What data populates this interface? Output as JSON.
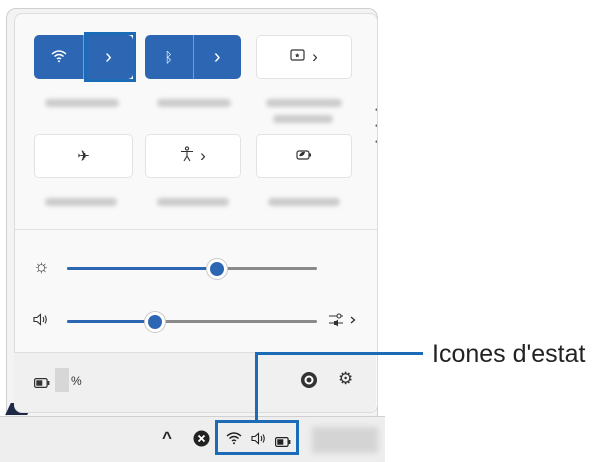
{
  "quick_settings": {
    "tiles_row1": [
      {
        "name": "wifi",
        "icon": "wifi-icon",
        "state": "on"
      },
      {
        "name": "bluetooth",
        "icon": "bluetooth-icon",
        "state": "on"
      },
      {
        "name": "screen-projection",
        "icon": "cast-icon",
        "state": "off"
      }
    ],
    "tiles_row2": [
      {
        "name": "airplane-mode",
        "icon": "airplane-icon",
        "state": "off"
      },
      {
        "name": "accessibility",
        "icon": "accessibility-icon",
        "state": "off"
      },
      {
        "name": "energy-saver",
        "icon": "energy-saver-icon",
        "state": "off"
      }
    ],
    "brightness_level": 0.6,
    "volume_level": 0.35,
    "battery_percent_suffix": "%"
  },
  "icons": {
    "arrow": "›",
    "wifi": "ᯤ",
    "bluetooth": "ᛒ",
    "airplane": "✈",
    "accessibility": "♿",
    "sun": "☼",
    "speaker": "🔈︎",
    "gear": "⚙",
    "chevron_up": "^",
    "close_circle": "✖"
  },
  "colors": {
    "accent": "#2d67b4",
    "callout": "#1b6bb6"
  },
  "callout": {
    "label": "Icones d'estat"
  }
}
